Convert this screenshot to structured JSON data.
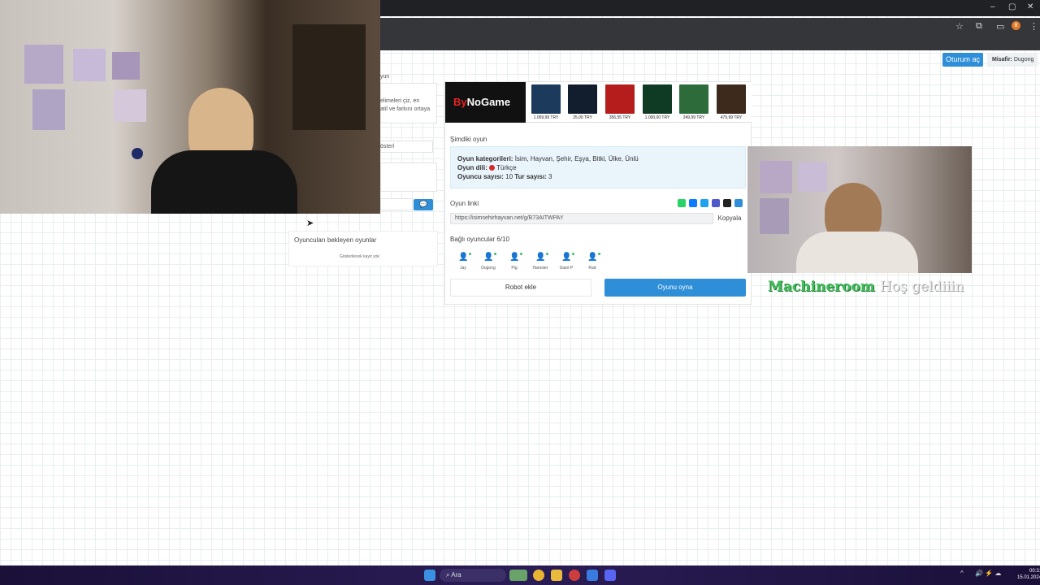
{
  "browser": {
    "window_controls": [
      "–",
      "▢",
      "✕"
    ],
    "toolbar_icons": [
      "star-icon",
      "extensions-icon",
      "profile-icon",
      "menu-icon"
    ],
    "profile_initial": "8"
  },
  "header": {
    "login_label": "Oturum aç",
    "guest_prefix": "Misafir:",
    "guest_name": "Dugong"
  },
  "left_panel": {
    "section_suffix": "yun",
    "desc_line1": "elimeleri çiz, en",
    "desc_line2": "atil ve farkını ortaya",
    "show_button_partial": "österl"
  },
  "waiting": {
    "title": "Oyuncuları bekleyen oyunlar",
    "empty": "Gösterilecek kayıt yok"
  },
  "ad": {
    "brand_prefix": "By",
    "brand_rest": "NoGame",
    "products": [
      {
        "price": "1.059,99 TRY",
        "color": "#1b3a5c",
        "caption": "25 USD"
      },
      {
        "price": "25,00 TRY",
        "color": "#121e2e",
        "caption": "Google Play"
      },
      {
        "price": "356,55 TRY",
        "color": "#b51d1d",
        "caption": "Antivirüs"
      },
      {
        "price": "1.000,00 TRY",
        "color": "#0f3a23",
        "caption": "2800"
      },
      {
        "price": "249,99 TRY",
        "color": "#2d6b3b",
        "caption": "GTA"
      },
      {
        "price": "479,99 TRY",
        "color": "#3d2a1c",
        "caption": "Game"
      }
    ]
  },
  "current_game": {
    "title": "Şimdiki oyun",
    "categories_label": "Oyun kategorileri:",
    "categories_value": "İsim, Hayvan, Şehir, Eşya, Bitki, Ülke, Ünlü",
    "language_label": "Oyun dili:",
    "language_value": "Türkçe",
    "player_count_label": "Oyuncu sayısı:",
    "player_count_value": "10",
    "round_count_label": "Tur sayısı:",
    "round_count_value": "3"
  },
  "link": {
    "title": "Oyun linki",
    "url": "https://isimsehirhayvan.net/g/B73AITWPAY",
    "copy_label": "Kopyala",
    "share_icons": [
      {
        "name": "whatsapp-icon",
        "color": "#25d366"
      },
      {
        "name": "messenger-icon",
        "color": "#0a7cff"
      },
      {
        "name": "twitter-icon",
        "color": "#1da1f2"
      },
      {
        "name": "teams-icon",
        "color": "#5059c9"
      },
      {
        "name": "snapchat-icon",
        "color": "#222222"
      },
      {
        "name": "share-plus-icon",
        "color": "#2e8fd8"
      }
    ]
  },
  "players": {
    "title": "Bağlı oyuncular 6/10",
    "list": [
      "Jay",
      "Dugong",
      "Pig",
      "Hamster",
      "Giant P",
      "Rad"
    ]
  },
  "actions": {
    "robot_label": "Robot ekle",
    "play_label": "Oyunu oyna"
  },
  "overlay": {
    "name": "Machineroom",
    "greeting": "Hoş geldiiin"
  },
  "taskbar": {
    "search_label": "Ara",
    "time": "00:31",
    "date": "15.01.2024"
  }
}
